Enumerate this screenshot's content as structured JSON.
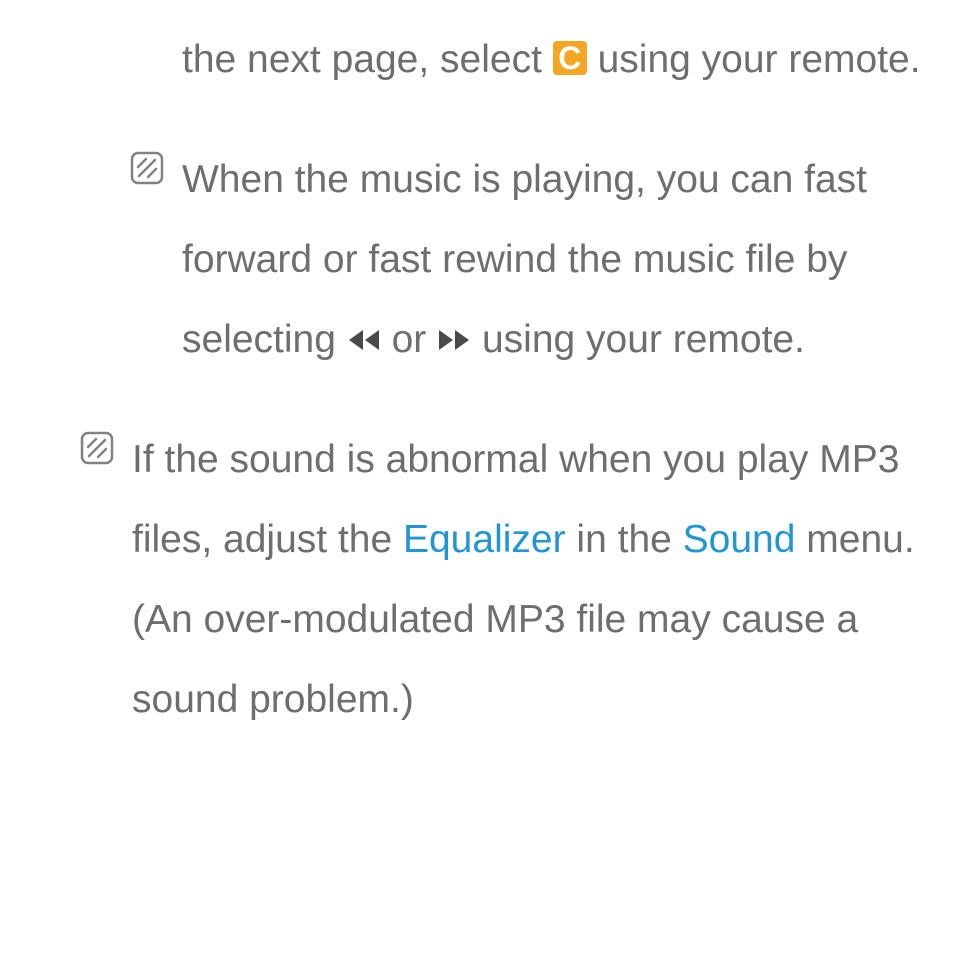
{
  "para1": {
    "t1": "the next page, select ",
    "c_label": "C",
    "t2": " using your remote."
  },
  "para2": {
    "t1": "When the music is playing, you can fast forward or fast rewind the music file by selecting ",
    "t2": " or ",
    "t3": " using your remote."
  },
  "para3": {
    "t1": "If the sound is abnormal when you play MP3 files, adjust the ",
    "kw1": "Equalizer",
    "t2": " in the ",
    "kw2": "Sound",
    "t3": " menu. (An over-modulated MP3 file may cause a sound problem.)"
  }
}
